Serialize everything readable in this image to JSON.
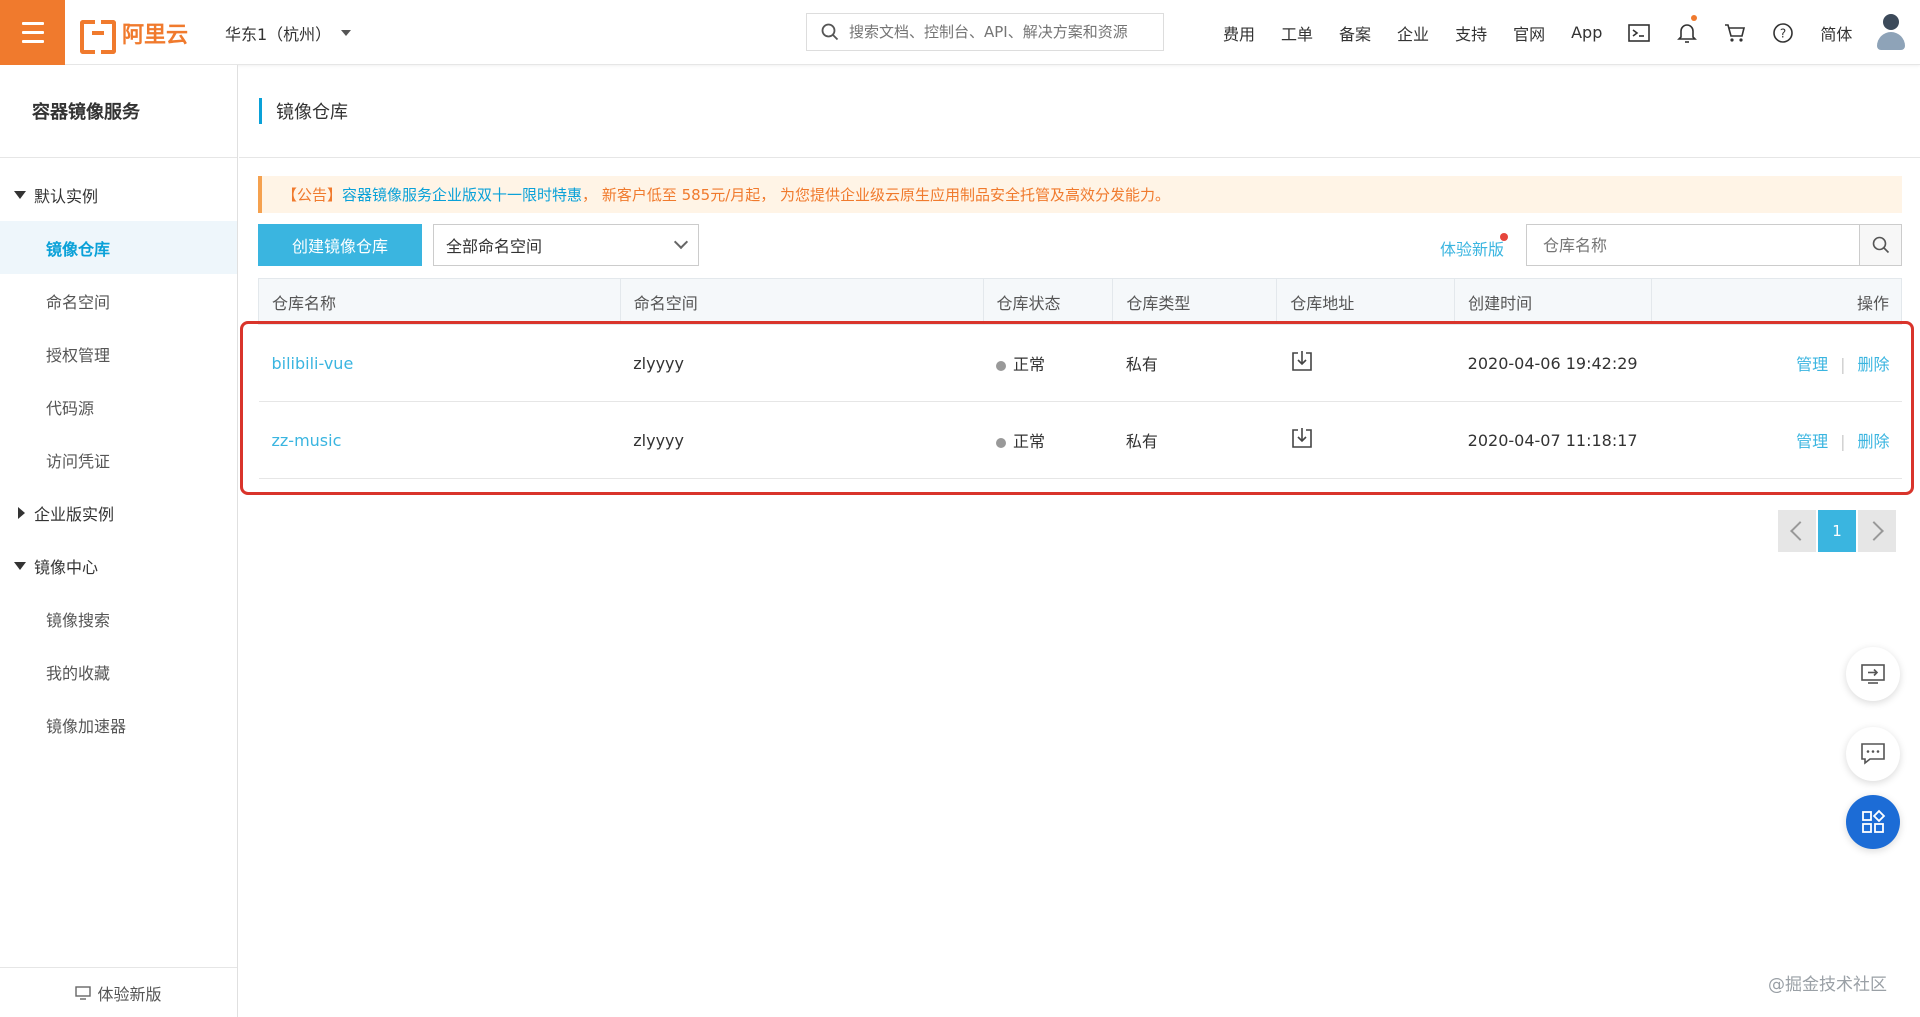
{
  "topbar": {
    "brand": "阿里云",
    "region": "华东1（杭州）",
    "search_placeholder": "搜索文档、控制台、API、解决方案和资源",
    "nav": [
      "费用",
      "工单",
      "备案",
      "企业",
      "支持",
      "官网",
      "App"
    ],
    "language": "简体",
    "icons": [
      "terminal-icon",
      "bell-icon",
      "cart-icon",
      "help-icon"
    ]
  },
  "sidebar": {
    "title": "容器镜像服务",
    "groups": [
      {
        "label": "默认实例",
        "expanded": true,
        "items": [
          "镜像仓库",
          "命名空间",
          "授权管理",
          "代码源",
          "访问凭证"
        ]
      },
      {
        "label": "企业版实例",
        "expanded": false,
        "items": []
      },
      {
        "label": "镜像中心",
        "expanded": true,
        "items": [
          "镜像搜索",
          "我的收藏",
          "镜像加速器"
        ]
      }
    ],
    "active_item": "镜像仓库",
    "footer": "体验新版"
  },
  "page": {
    "title": "镜像仓库",
    "notice_prefix": "【公告】",
    "notice_link": "容器镜像服务企业版",
    "notice_highlight": "双十一限时特惠",
    "notice_rest": "， 新客户低至 585元/月起， 为您提供企业级云原生应用制品安全托管及高效分发能力。",
    "create_button": "创建镜像仓库",
    "namespace_select": "全部命名空间",
    "try_new": "体验新版",
    "search_placeholder": "仓库名称"
  },
  "table": {
    "headers": [
      "仓库名称",
      "命名空间",
      "仓库状态",
      "仓库类型",
      "仓库地址",
      "创建时间",
      "操作"
    ],
    "rows": [
      {
        "name": "bilibili-vue",
        "namespace": "zlyyyy",
        "status": "正常",
        "type": "私有",
        "created": "2020-04-06 19:42:29",
        "op_manage": "管理",
        "op_delete": "删除"
      },
      {
        "name": "zz-music",
        "namespace": "zlyyyy",
        "status": "正常",
        "type": "私有",
        "created": "2020-04-07 11:18:17",
        "op_manage": "管理",
        "op_delete": "删除"
      }
    ]
  },
  "pagination": {
    "current": "1"
  },
  "watermark": "@掘金技术社区",
  "colors": {
    "brand_orange": "#f07a2d",
    "accent_blue": "#3ab5e0",
    "highlight_red": "#d9342b"
  }
}
